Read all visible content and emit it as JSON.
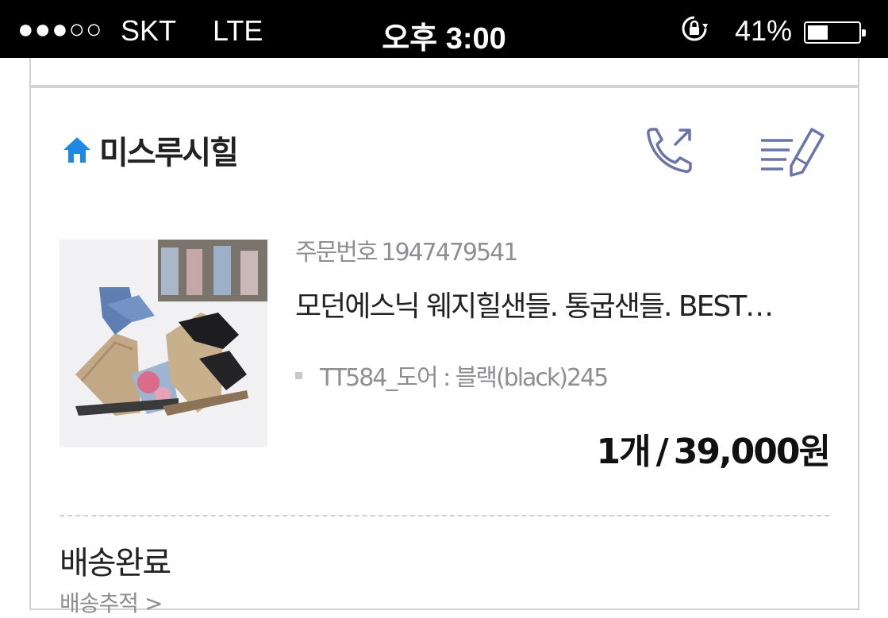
{
  "status_bar": {
    "signal": "●●●○○",
    "carrier": "SKT",
    "network": "LTE",
    "time": "오후 3:00",
    "orientation_lock_icon": "orientation-lock-icon",
    "battery_percent": "41%",
    "battery_level": 0.41
  },
  "shop": {
    "icon": "home-icon",
    "name": "미스루시힐",
    "call_icon": "phone-call-icon",
    "review_icon": "write-review-icon",
    "accent_color": "#1e88e5",
    "icon_color": "#6a74a8"
  },
  "order": {
    "order_number_label": "주문번호",
    "order_number": "1947479541",
    "product_name": "모던에스닉 웨지힐샌들. 통굽샌들. BEST…",
    "option": "TT584_도어 : 블랙(black)245",
    "quantity": "1개",
    "separator": "/",
    "price": "39,000원"
  },
  "delivery": {
    "status": "배송완료",
    "tracking_link": "배송추적 >"
  }
}
